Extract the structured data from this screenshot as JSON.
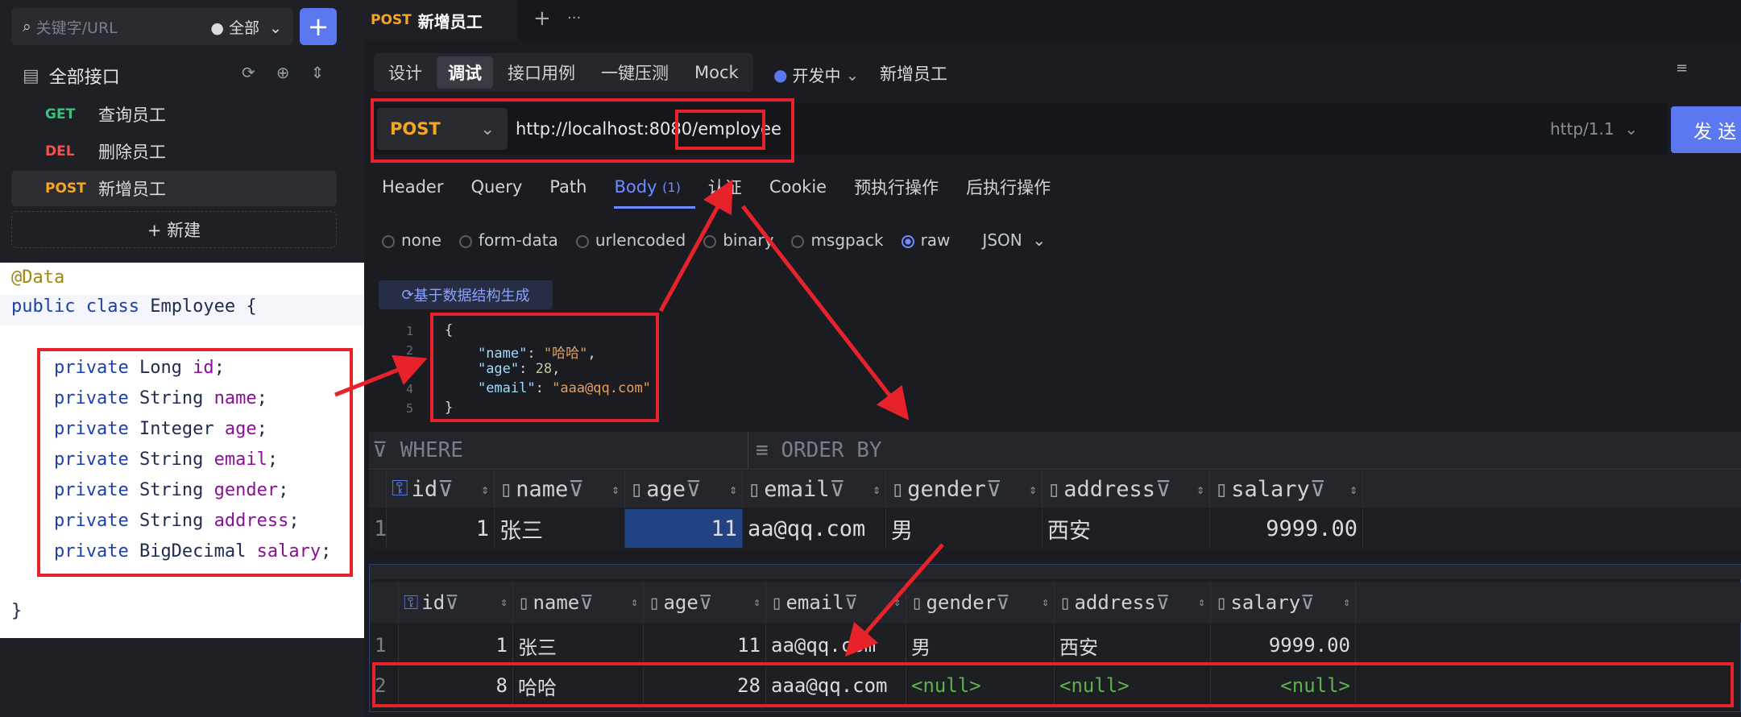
{
  "sidebar": {
    "search_placeholder": "关键字/URL",
    "scope": "全部",
    "title": "全部接口",
    "items": [
      {
        "method": "GET",
        "name": "查询员工",
        "color": "#3fbf7f"
      },
      {
        "method": "DEL",
        "name": "删除员工",
        "color": "#f0524f"
      },
      {
        "method": "POST",
        "name": "新增员工",
        "color": "#f5a623"
      }
    ],
    "new_label": "+ 新建"
  },
  "code": {
    "lines": [
      "@Data",
      "public class Employee {",
      "",
      "    private Long id;",
      "    private String name;",
      "    private Integer age;",
      "    private String email;",
      "    private String gender;",
      "    private String address;",
      "    private BigDecimal salary;",
      "",
      "}"
    ]
  },
  "tab": {
    "method": "POST",
    "title": "新增员工",
    "add": "+",
    "more": "···"
  },
  "subtabs": [
    "设计",
    "调试",
    "接口用例",
    "一键压测",
    "Mock"
  ],
  "env": "开发中",
  "api_name": "新增员工",
  "request": {
    "method": "POST",
    "url_base": "http://localhost:8080/",
    "url_path": "employee",
    "protocol": "http/1.1",
    "send": "发 送"
  },
  "req_tabs": [
    "Header",
    "Query",
    "Path",
    "Body",
    "认证",
    "Cookie",
    "预执行操作",
    "后执行操作"
  ],
  "body_count": "(1)",
  "body_types": [
    "none",
    "form-data",
    "urlencoded",
    "binary",
    "msgpack",
    "raw"
  ],
  "body_format": "JSON",
  "gen_button": "基于数据结构生成",
  "json_lines": [
    "{",
    "    \"name\": \"哈哈\",",
    "    \"age\": 28,",
    "    \"email\": \"aaa@qq.com\"",
    "}"
  ],
  "grid": {
    "where": "WHERE",
    "order_by": "ORDER BY",
    "columns": [
      "id",
      "name",
      "age",
      "email",
      "gender",
      "address",
      "salary"
    ],
    "before": [
      [
        "1",
        "1",
        "张三",
        "11",
        "aa@qq.com",
        "男",
        "西安",
        "9999.00"
      ]
    ],
    "after": [
      [
        "1",
        "1",
        "张三",
        "11",
        "aa@qq.com",
        "男",
        "西安",
        "9999.00"
      ],
      [
        "2",
        "8",
        "哈哈",
        "28",
        "aaa@qq.com",
        "<null>",
        "<null>",
        "<null>"
      ]
    ]
  }
}
